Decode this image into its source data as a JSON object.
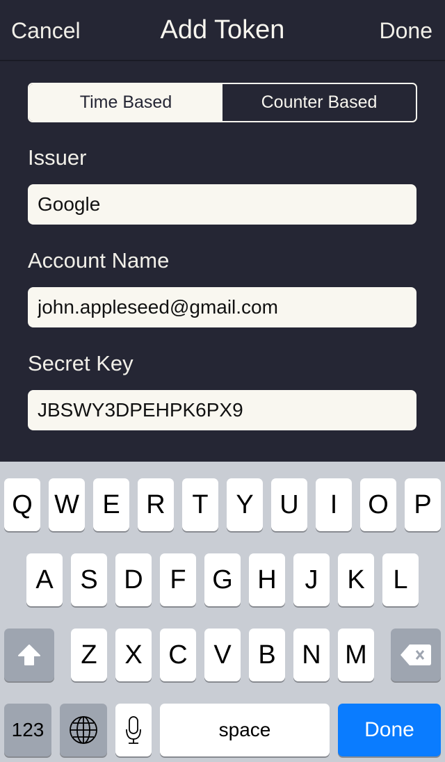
{
  "nav": {
    "cancel": "Cancel",
    "title": "Add Token",
    "done": "Done"
  },
  "segmented": {
    "options": [
      "Time Based",
      "Counter Based"
    ],
    "selected": "Time Based"
  },
  "form": {
    "issuer_label": "Issuer",
    "issuer_value": "Google",
    "account_label": "Account Name",
    "account_value": "john.appleseed@gmail.com",
    "secret_label": "Secret Key",
    "secret_value": "JBSWY3DPEHPK6PX9"
  },
  "keyboard": {
    "row1": [
      "Q",
      "W",
      "E",
      "R",
      "T",
      "Y",
      "U",
      "I",
      "O",
      "P"
    ],
    "row2": [
      "A",
      "S",
      "D",
      "F",
      "G",
      "H",
      "J",
      "K",
      "L"
    ],
    "row3": [
      "Z",
      "X",
      "C",
      "V",
      "B",
      "N",
      "M"
    ],
    "numbers": "123",
    "space": "space",
    "done": "Done",
    "icons": {
      "shift": "shift-arrow-icon",
      "delete": "backspace-icon",
      "globe": "globe-icon",
      "mic": "microphone-icon"
    },
    "done_color": "#0a7cff"
  },
  "colors": {
    "background": "#252634",
    "field": "#f9f7f0",
    "keyboard": "#c9cdd4"
  }
}
